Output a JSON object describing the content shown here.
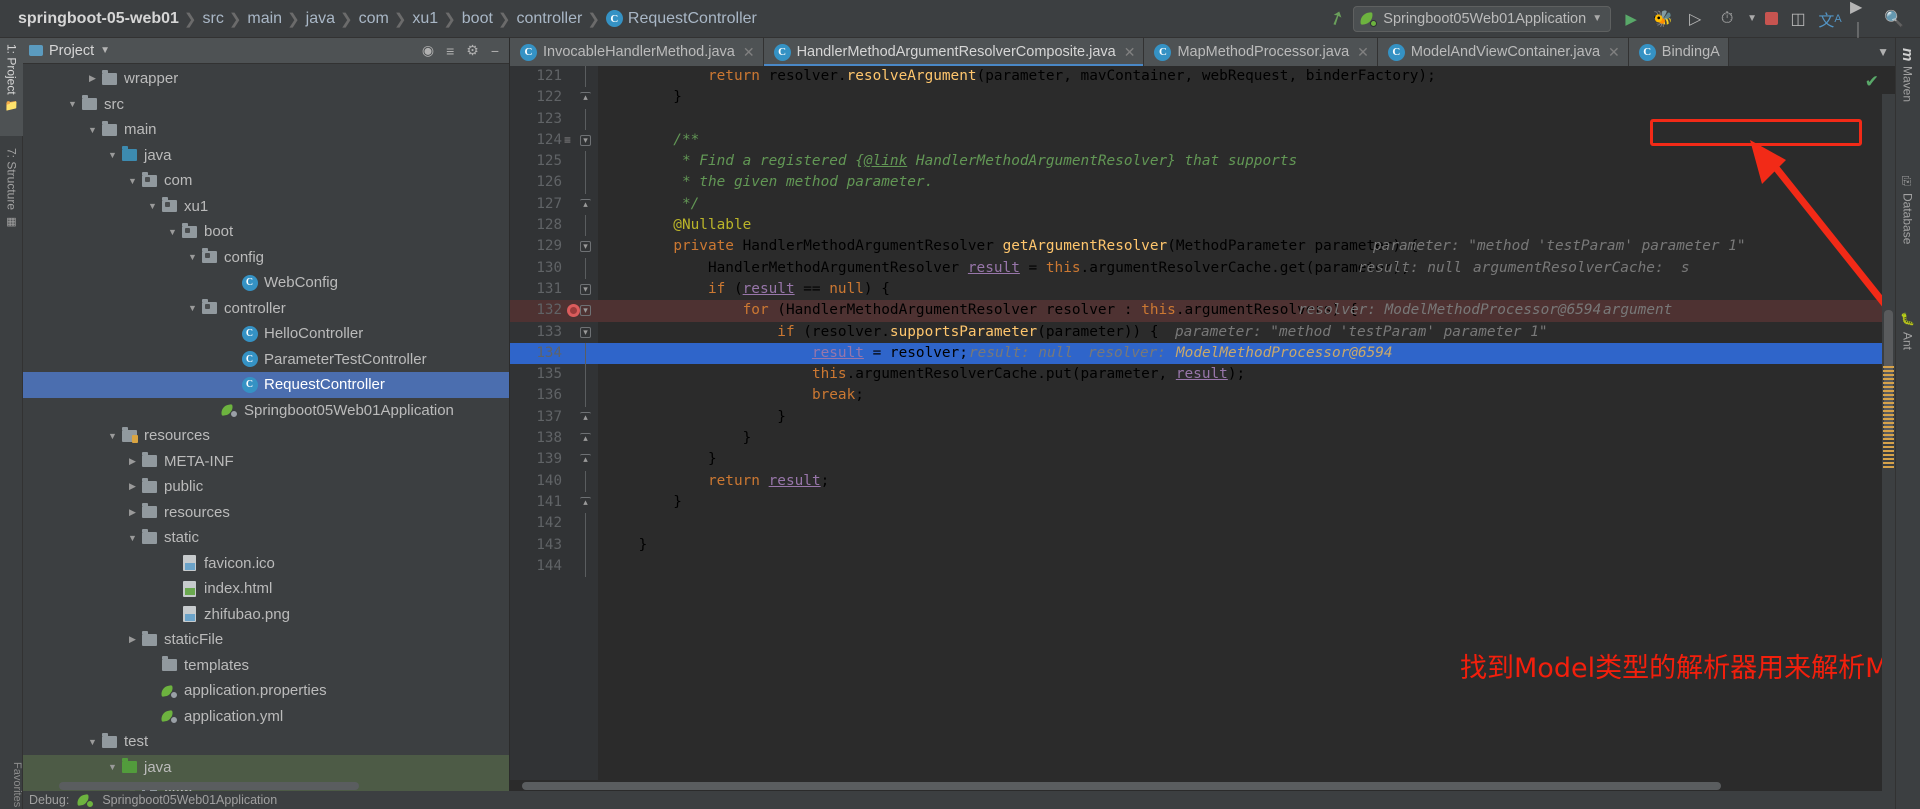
{
  "breadcrumb": {
    "project": "springboot-05-web01",
    "items": [
      "src",
      "main",
      "java",
      "com",
      "xu1",
      "boot",
      "controller"
    ],
    "class": "RequestController",
    "class_icon": "class-icon"
  },
  "toolbar": {
    "build_icon": "hammer-icon",
    "run_config": "Springboot05Web01Application",
    "run_config_icon": "spring-boot-icon",
    "dropdown_icon": "chevron-down-icon",
    "run_icon": "run-icon",
    "debug_icon": "debug-icon",
    "run_coverage_icon": "run-with-coverage-icon",
    "profiler_icon": "profiler-icon",
    "profiler_caret_icon": "chevron-down-icon",
    "stop_icon": "stop-icon",
    "layout_icon": "layout-icon",
    "translate_icon": "translate-icon",
    "terminal_icon": "terminal-icon",
    "search_icon": "search-icon"
  },
  "left_strip": {
    "tabs": [
      {
        "label": "1: Project",
        "icon": "project-folder-icon",
        "active": true
      },
      {
        "label": "7: Structure",
        "icon": "structure-icon",
        "active": false
      }
    ],
    "bottom_label": "Favorites"
  },
  "right_strip": {
    "tabs": [
      {
        "label": "Maven",
        "icon": "maven-icon"
      },
      {
        "label": "Database",
        "icon": "database-icon"
      },
      {
        "label": "Ant",
        "icon": "ant-icon"
      }
    ]
  },
  "project_panel": {
    "title": "Project",
    "title_caret": "chevron-down-icon",
    "header_icons": [
      "locate-icon",
      "collapse-all-icon",
      "settings-gear-icon",
      "hide-icon"
    ],
    "tree": [
      {
        "label": "wrapper",
        "indent": 3,
        "twist": "collapsed",
        "icon": "folder-grey",
        "selected": false
      },
      {
        "label": "src",
        "indent": 2,
        "twist": "expanded",
        "icon": "folder-grey",
        "selected": false
      },
      {
        "label": "main",
        "indent": 3,
        "twist": "expanded",
        "icon": "folder-grey",
        "selected": false
      },
      {
        "label": "java",
        "indent": 4,
        "twist": "expanded",
        "icon": "folder-blue",
        "selected": false
      },
      {
        "label": "com",
        "indent": 5,
        "twist": "expanded",
        "icon": "folder-package",
        "selected": false
      },
      {
        "label": "xu1",
        "indent": 6,
        "twist": "expanded",
        "icon": "folder-package",
        "selected": false
      },
      {
        "label": "boot",
        "indent": 7,
        "twist": "expanded",
        "icon": "folder-package",
        "selected": false
      },
      {
        "label": "config",
        "indent": 8,
        "twist": "expanded",
        "icon": "folder-package",
        "selected": false
      },
      {
        "label": "WebConfig",
        "indent": 10,
        "twist": "none",
        "icon": "class-icon",
        "selected": false
      },
      {
        "label": "controller",
        "indent": 8,
        "twist": "expanded",
        "icon": "folder-package",
        "selected": false
      },
      {
        "label": "HelloController",
        "indent": 10,
        "twist": "none",
        "icon": "class-icon",
        "selected": false
      },
      {
        "label": "ParameterTestController",
        "indent": 10,
        "twist": "none",
        "icon": "class-icon",
        "selected": false
      },
      {
        "label": "RequestController",
        "indent": 10,
        "twist": "none",
        "icon": "class-icon",
        "selected": true
      },
      {
        "label": "Springboot05Web01Application",
        "indent": 9,
        "twist": "none",
        "icon": "spring-run-icon",
        "selected": false
      },
      {
        "label": "resources",
        "indent": 4,
        "twist": "expanded",
        "icon": "folder-resources",
        "selected": false
      },
      {
        "label": "META-INF",
        "indent": 5,
        "twist": "collapsed",
        "icon": "folder-grey",
        "selected": false
      },
      {
        "label": "public",
        "indent": 5,
        "twist": "collapsed",
        "icon": "folder-grey",
        "selected": false
      },
      {
        "label": "resources",
        "indent": 5,
        "twist": "collapsed",
        "icon": "folder-grey",
        "selected": false
      },
      {
        "label": "static",
        "indent": 5,
        "twist": "expanded",
        "icon": "folder-grey",
        "selected": false
      },
      {
        "label": "favicon.ico",
        "indent": 7,
        "twist": "none",
        "icon": "image-file-icon",
        "selected": false
      },
      {
        "label": "index.html",
        "indent": 7,
        "twist": "none",
        "icon": "html-file-icon",
        "selected": false
      },
      {
        "label": "zhifubao.png",
        "indent": 7,
        "twist": "none",
        "icon": "image-file-icon",
        "selected": false
      },
      {
        "label": "staticFile",
        "indent": 5,
        "twist": "collapsed",
        "icon": "folder-grey",
        "selected": false
      },
      {
        "label": "templates",
        "indent": 6,
        "twist": "none",
        "icon": "folder-grey",
        "selected": false
      },
      {
        "label": "application.properties",
        "indent": 6,
        "twist": "none",
        "icon": "spring-file-icon",
        "selected": false
      },
      {
        "label": "application.yml",
        "indent": 6,
        "twist": "none",
        "icon": "spring-file-icon",
        "selected": false
      },
      {
        "label": "test",
        "indent": 3,
        "twist": "expanded",
        "icon": "folder-grey",
        "selected": false
      },
      {
        "label": "java",
        "indent": 4,
        "twist": "expanded",
        "icon": "folder-green",
        "selected": false,
        "row_highlight": "test"
      },
      {
        "label": "com",
        "indent": 5,
        "twist": "expanded",
        "icon": "folder-package",
        "selected": false,
        "row_highlight": "test"
      }
    ]
  },
  "editor": {
    "tabs": [
      {
        "label": "InvocableHandlerMethod.java",
        "icon": "class-icon",
        "active": false,
        "close_icon": "close-icon"
      },
      {
        "label": "HandlerMethodArgumentResolverComposite.java",
        "icon": "class-icon",
        "active": true,
        "close_icon": "close-icon"
      },
      {
        "label": "MapMethodProcessor.java",
        "icon": "class-icon",
        "active": false,
        "close_icon": "close-icon"
      },
      {
        "label": "ModelAndViewContainer.java",
        "icon": "class-icon",
        "active": false,
        "close_icon": "close-icon"
      },
      {
        "label": "BindingA",
        "icon": "class-icon",
        "active": false,
        "close_icon": ""
      }
    ],
    "tabs_overflow_icon": "chevron-down-icon",
    "inspection_status_icon": "checkmark-icon",
    "first_line_number": 121,
    "lines": [
      {
        "n": 121,
        "fold": "",
        "state": "",
        "code": "            return resolver.resolveArgument(parameter, mavContainer, webRequest, binderFactory);"
      },
      {
        "n": 122,
        "fold": "end",
        "state": "",
        "code": "        }"
      },
      {
        "n": 123,
        "fold": "",
        "state": "",
        "code": ""
      },
      {
        "n": 124,
        "fold": "start",
        "state": "",
        "code": "        /**"
      },
      {
        "n": 125,
        "fold": "",
        "state": "",
        "code": "         * Find a registered {@link HandlerMethodArgumentResolver} that supports"
      },
      {
        "n": 126,
        "fold": "",
        "state": "",
        "code": "         * the given method parameter."
      },
      {
        "n": 127,
        "fold": "end",
        "state": "",
        "code": "         */"
      },
      {
        "n": 128,
        "fold": "",
        "state": "",
        "code": "        @Nullable"
      },
      {
        "n": 129,
        "fold": "start",
        "state": "",
        "code": "        private HandlerMethodArgumentResolver getArgumentResolver(MethodParameter parameter) {"
      },
      {
        "n": 130,
        "fold": "",
        "state": "",
        "code": "            HandlerMethodArgumentResolver result = this.argumentResolverCache.get(parameter);"
      },
      {
        "n": 131,
        "fold": "start",
        "state": "",
        "code": "            if (result == null) {"
      },
      {
        "n": 132,
        "fold": "start",
        "state": "breakpoint",
        "code": "                for (HandlerMethodArgumentResolver resolver : this.argumentResolvers) {"
      },
      {
        "n": 133,
        "fold": "start",
        "state": "",
        "code": "                    if (resolver.supportsParameter(parameter)) {"
      },
      {
        "n": 134,
        "fold": "",
        "state": "selected",
        "code": "                        result = resolver;"
      },
      {
        "n": 135,
        "fold": "",
        "state": "",
        "code": "                        this.argumentResolverCache.put(parameter, result);"
      },
      {
        "n": 136,
        "fold": "",
        "state": "",
        "code": "                        break;"
      },
      {
        "n": 137,
        "fold": "end",
        "state": "",
        "code": "                    }"
      },
      {
        "n": 138,
        "fold": "end",
        "state": "",
        "code": "                }"
      },
      {
        "n": 139,
        "fold": "end",
        "state": "",
        "code": "            }"
      },
      {
        "n": 140,
        "fold": "",
        "state": "",
        "code": "            return result;"
      },
      {
        "n": 141,
        "fold": "end",
        "state": "",
        "code": "        }"
      },
      {
        "n": 142,
        "fold": "",
        "state": "",
        "code": ""
      },
      {
        "n": 143,
        "fold": "",
        "state": "",
        "code": "    }"
      },
      {
        "n": 144,
        "fold": "",
        "state": "",
        "code": ""
      }
    ],
    "inline_hints": {
      "line129": "parameter: \"method 'testParam' parameter 1\"",
      "line130_a": "result: null",
      "line130_b": "argumentResolverCache:  s",
      "line132_a": "resolver: ModelMethodProcessor@6594",
      "line132_b": "argument",
      "line133": "parameter: \"method 'testParam' parameter 1\"",
      "line134_a": "result: null",
      "line134_b": "resolver:",
      "line134_highlight": "ModelMethodProcessor@6594"
    }
  },
  "annotation": {
    "text": "找到Model类型的解析器用来解析Model类型的参数",
    "color": "#f31f0c",
    "box_color": "#f22a17",
    "arrow": "arrow-pointing-up-left"
  },
  "status_bar": {
    "text": "Debug:",
    "app": "Springboot05Web01Application"
  }
}
